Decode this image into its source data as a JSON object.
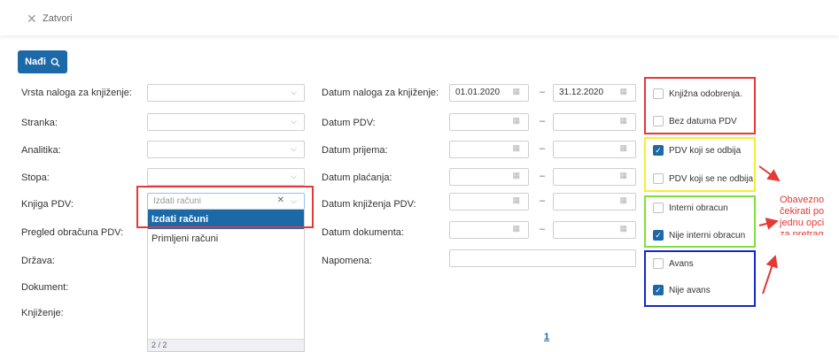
{
  "header": {
    "close_label": "Zatvori"
  },
  "search_button": {
    "label": "Nađi"
  },
  "left_fields": [
    {
      "label": "Vrsta naloga za knjiženje:"
    },
    {
      "label": "Stranka:"
    },
    {
      "label": "Analitika:"
    },
    {
      "label": "Stopa:"
    },
    {
      "label": "Knjiga PDV:"
    },
    {
      "label": "Pregled obračuna PDV:"
    },
    {
      "label": "Država:"
    },
    {
      "label": "Dokument:"
    },
    {
      "label": "Knjiženje:"
    }
  ],
  "knjiga_pdv": {
    "placeholder": "Izdati računi",
    "options": [
      "Izdati računi",
      "Primljeni računi"
    ],
    "selected_index": 0,
    "footer": "2 / 2"
  },
  "middle_fields": [
    {
      "label": "Datum naloga za knjiženje:",
      "from": "01.01.2020",
      "to": "31.12.2020"
    },
    {
      "label": "Datum PDV:",
      "from": "",
      "to": ""
    },
    {
      "label": "Datum prijema:",
      "from": "",
      "to": ""
    },
    {
      "label": "Datum plaćanja:",
      "from": "",
      "to": ""
    },
    {
      "label": "Datum knjiženja PDV:",
      "from": "",
      "to": ""
    },
    {
      "label": "Datum dokumenta:",
      "from": "",
      "to": ""
    },
    {
      "label": "Napomena:"
    }
  ],
  "range_separator": "–",
  "checkbox_groups": [
    {
      "border_color": "#e53935",
      "items": [
        {
          "label": "Knjižna odobrenja.",
          "checked": false
        },
        {
          "label": "Bez datuma PDV",
          "checked": false
        }
      ]
    },
    {
      "border_color": "#f0f032",
      "items": [
        {
          "label": "PDV koji se odbija",
          "checked": true
        },
        {
          "label": "PDV koji se ne odbija",
          "checked": false
        }
      ]
    },
    {
      "border_color": "#7ee03a",
      "items": [
        {
          "label": "Interni obracun",
          "checked": false
        },
        {
          "label": "Nije interni obracun",
          "checked": true
        }
      ]
    },
    {
      "border_color": "#1427c8",
      "items": [
        {
          "label": "Avans",
          "checked": false
        },
        {
          "label": "Nije avans",
          "checked": true
        }
      ]
    }
  ],
  "pagination": {
    "page": "1"
  },
  "annotation": {
    "lines": [
      "Obavezno",
      "čekirati po",
      "jednu opci",
      "za pretrag"
    ],
    "color": "#e53935"
  }
}
